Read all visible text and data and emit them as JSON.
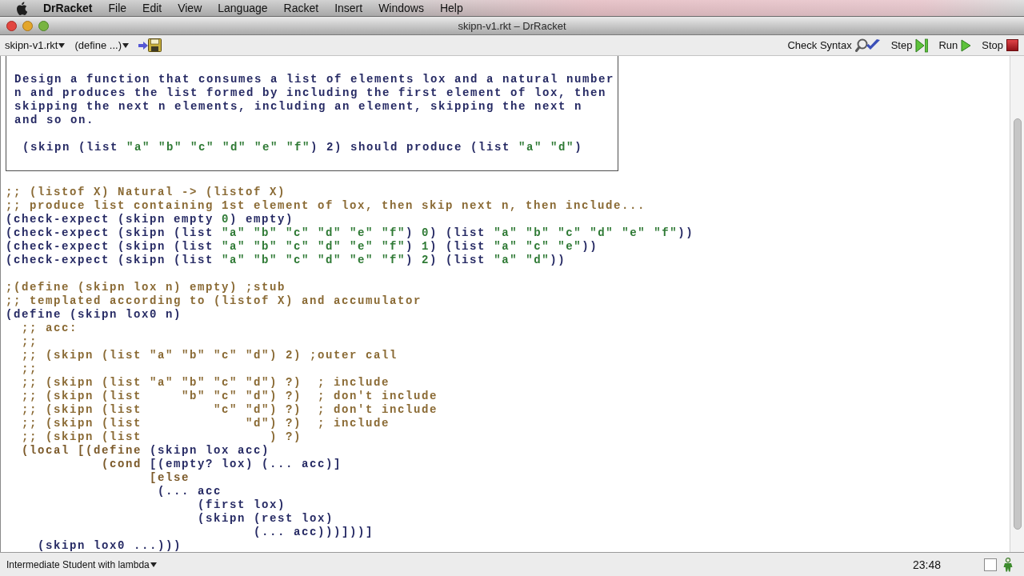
{
  "menu_bar": {
    "app_name": "DrRacket",
    "items": [
      "File",
      "Edit",
      "View",
      "Language",
      "Racket",
      "Insert",
      "Windows",
      "Help"
    ]
  },
  "window": {
    "title": "skipn-v1.rkt – DrRacket"
  },
  "toolbar": {
    "file_menu": "skipn-v1.rkt",
    "definitions_menu": "(define ...)",
    "buttons": [
      {
        "kind": "check_syntax",
        "label": "Check Syntax"
      },
      {
        "kind": "step",
        "label": "Step"
      },
      {
        "kind": "run",
        "label": "Run"
      },
      {
        "kind": "stop",
        "label": "Stop"
      }
    ]
  },
  "editor": {
    "comment_box": {
      "description": [
        "Design a function that consumes a list of elements lox and a natural number",
        "n and produces the list formed by including the first element of lox, then",
        "skipping the next n elements, including an element, skipping the next n",
        "and so on."
      ],
      "example": [
        {
          "kind": "symbol",
          "text": " (skipn (list "
        },
        {
          "kind": "literal",
          "text": "\"a\" \"b\" \"c\" \"d\" \"e\" \"f\""
        },
        {
          "kind": "symbol",
          "text": ") 2) should produce (list "
        },
        {
          "kind": "literal",
          "text": "\"a\" \"d\""
        },
        {
          "kind": "symbol",
          "text": ")"
        }
      ]
    },
    "blocks": [
      {
        "lines": [
          {
            "tokens": [
              {
                "kind": "comment",
                "text": ";; (listof X) Natural -> (listof X)"
              }
            ]
          },
          {
            "tokens": [
              {
                "kind": "comment",
                "text": ";; produce list containing 1st element of lox, then skip next n, then include..."
              }
            ]
          },
          {
            "tokens": [
              {
                "kind": "symbol",
                "text": "(check-expect (skipn empty "
              },
              {
                "kind": "literal",
                "text": "0"
              },
              {
                "kind": "symbol",
                "text": ") empty)"
              }
            ]
          },
          {
            "tokens": [
              {
                "kind": "symbol",
                "text": "(check-expect (skipn (list "
              },
              {
                "kind": "literal",
                "text": "\"a\" \"b\" \"c\" \"d\" \"e\" \"f\""
              },
              {
                "kind": "symbol",
                "text": ") "
              },
              {
                "kind": "literal",
                "text": "0"
              },
              {
                "kind": "symbol",
                "text": ") (list "
              },
              {
                "kind": "literal",
                "text": "\"a\" \"b\" \"c\" \"d\" \"e\" \"f\""
              },
              {
                "kind": "symbol",
                "text": "))"
              }
            ]
          },
          {
            "tokens": [
              {
                "kind": "symbol",
                "text": "(check-expect (skipn (list "
              },
              {
                "kind": "literal",
                "text": "\"a\" \"b\" \"c\" \"d\" \"e\" \"f\""
              },
              {
                "kind": "symbol",
                "text": ") "
              },
              {
                "kind": "literal",
                "text": "1"
              },
              {
                "kind": "symbol",
                "text": ") (list "
              },
              {
                "kind": "literal",
                "text": "\"a\" \"c\" \"e\""
              },
              {
                "kind": "symbol",
                "text": "))"
              }
            ]
          },
          {
            "tokens": [
              {
                "kind": "symbol",
                "text": "(check-expect (skipn (list "
              },
              {
                "kind": "literal",
                "text": "\"a\" \"b\" \"c\" \"d\" \"e\" \"f\""
              },
              {
                "kind": "symbol",
                "text": ") "
              },
              {
                "kind": "literal",
                "text": "2"
              },
              {
                "kind": "symbol",
                "text": ") (list "
              },
              {
                "kind": "literal",
                "text": "\"a\" \"d\""
              },
              {
                "kind": "symbol",
                "text": "))"
              }
            ]
          }
        ]
      },
      {
        "lines": [
          {
            "tokens": [
              {
                "kind": "comment",
                "text": ";(define (skipn lox n) empty) ;stub"
              }
            ]
          },
          {
            "tokens": [
              {
                "kind": "comment",
                "text": ";; templated according to (listof X) and accumulator"
              }
            ]
          },
          {
            "tokens": [
              {
                "kind": "symbol",
                "text": "(define (skipn lox0 n)"
              }
            ]
          },
          {
            "tokens": [
              {
                "kind": "comment",
                "text": "  ;; acc:"
              }
            ]
          },
          {
            "tokens": [
              {
                "kind": "comment",
                "text": "  ;;"
              }
            ]
          },
          {
            "tokens": [
              {
                "kind": "comment",
                "text": "  ;; (skipn (list \"a\" \"b\" \"c\" \"d\") 2) ;outer call"
              }
            ]
          },
          {
            "tokens": [
              {
                "kind": "comment",
                "text": "  ;;"
              }
            ]
          },
          {
            "tokens": [
              {
                "kind": "comment",
                "text": "  ;; (skipn (list \"a\" \"b\" \"c\" \"d\") ?)  ; include"
              }
            ]
          },
          {
            "tokens": [
              {
                "kind": "comment",
                "text": "  ;; (skipn (list     \"b\" \"c\" \"d\") ?)  ; don't include"
              }
            ]
          },
          {
            "tokens": [
              {
                "kind": "comment",
                "text": "  ;; (skipn (list         \"c\" \"d\") ?)  ; don't include"
              }
            ]
          },
          {
            "tokens": [
              {
                "kind": "comment",
                "text": "  ;; (skipn (list             \"d\") ?)  ; include"
              }
            ]
          },
          {
            "tokens": [
              {
                "kind": "comment",
                "text": "  ;; (skipn (list                ) ?)"
              }
            ]
          },
          {
            "tokens": [
              {
                "kind": "keyword",
                "text": "  (local [(define "
              },
              {
                "kind": "symbol",
                "text": "(skipn lox acc)"
              }
            ]
          },
          {
            "tokens": [
              {
                "kind": "keyword",
                "text": "            (cond "
              },
              {
                "kind": "symbol",
                "text": "[(empty? lox) (... acc)]"
              }
            ]
          },
          {
            "tokens": [
              {
                "kind": "keyword",
                "text": "                  [else"
              }
            ]
          },
          {
            "tokens": [
              {
                "kind": "symbol",
                "text": "                   (... acc"
              }
            ]
          },
          {
            "tokens": [
              {
                "kind": "symbol",
                "text": "                        (first lox)"
              }
            ]
          },
          {
            "tokens": [
              {
                "kind": "symbol",
                "text": "                        (skipn (rest lox)"
              }
            ]
          },
          {
            "tokens": [
              {
                "kind": "symbol",
                "text": "                               (... acc)))]))]"
              }
            ]
          },
          {
            "tokens": [
              {
                "kind": "symbol",
                "text": "    (skipn lox0 ...)))"
              }
            ]
          }
        ]
      }
    ]
  },
  "status_bar": {
    "language": "Intermediate Student with lambda",
    "position": "23:48"
  }
}
